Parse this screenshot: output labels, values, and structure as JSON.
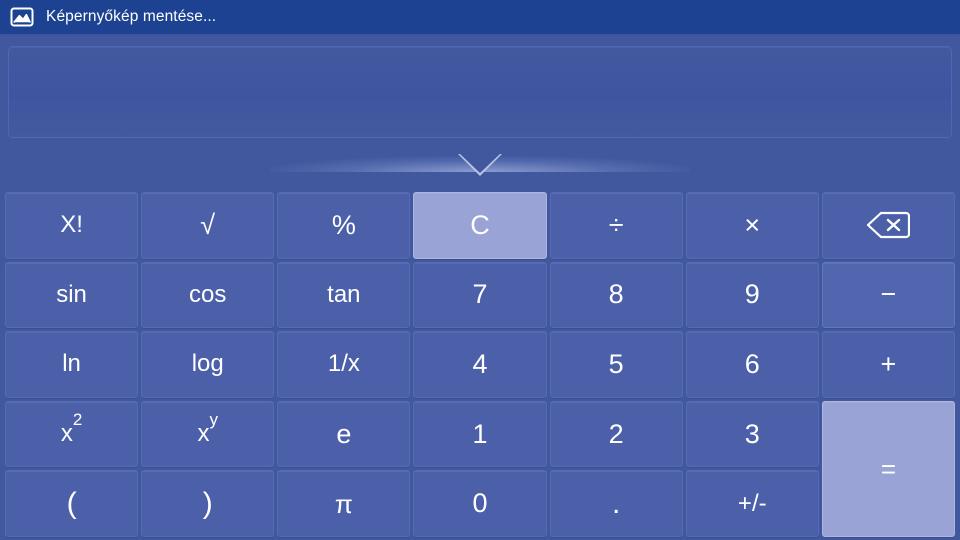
{
  "titlebar": {
    "icon": "image-picture-icon",
    "text": "Képernyőkép mentése..."
  },
  "display": {
    "value": "",
    "placeholder": ""
  },
  "colors": {
    "titlebar_bg": "#1c4291",
    "app_bg": "#41589f",
    "key_bg": "#4b60a9",
    "key_alt_bg": "#5266b0",
    "key_highlight_bg": "#9aa3d6",
    "key_text": "#ffffff",
    "caret": "#b9c4ea"
  },
  "keypad": {
    "columns": 7,
    "rows": 5,
    "keys": [
      {
        "id": "factorial",
        "label": "X!",
        "name": "key-factorial",
        "style": "normal"
      },
      {
        "id": "sqrt",
        "label": "√",
        "name": "key-square-root",
        "style": "normal"
      },
      {
        "id": "percent",
        "label": "%",
        "name": "key-percent",
        "style": "normal"
      },
      {
        "id": "clear",
        "label": "C",
        "name": "key-clear",
        "style": "highlight"
      },
      {
        "id": "divide",
        "label": "÷",
        "name": "key-divide",
        "style": "normal"
      },
      {
        "id": "multiply",
        "label": "×",
        "name": "key-multiply",
        "style": "normal"
      },
      {
        "id": "backspace",
        "label": "",
        "name": "key-backspace",
        "style": "normal"
      },
      {
        "id": "sin",
        "label": "sin",
        "name": "key-sin",
        "style": "normal"
      },
      {
        "id": "cos",
        "label": "cos",
        "name": "key-cos",
        "style": "normal"
      },
      {
        "id": "tan",
        "label": "tan",
        "name": "key-tan",
        "style": "normal"
      },
      {
        "id": "7",
        "label": "7",
        "name": "key-digit-7",
        "style": "normal"
      },
      {
        "id": "8",
        "label": "8",
        "name": "key-digit-8",
        "style": "normal"
      },
      {
        "id": "9",
        "label": "9",
        "name": "key-digit-9",
        "style": "normal"
      },
      {
        "id": "minus",
        "label": "−",
        "name": "key-minus",
        "style": "alt"
      },
      {
        "id": "ln",
        "label": "ln",
        "name": "key-ln",
        "style": "normal"
      },
      {
        "id": "log",
        "label": "log",
        "name": "key-log",
        "style": "normal"
      },
      {
        "id": "invx",
        "label": "1/x",
        "name": "key-reciprocal",
        "style": "normal"
      },
      {
        "id": "4",
        "label": "4",
        "name": "key-digit-4",
        "style": "normal"
      },
      {
        "id": "5",
        "label": "5",
        "name": "key-digit-5",
        "style": "normal"
      },
      {
        "id": "6",
        "label": "6",
        "name": "key-digit-6",
        "style": "normal"
      },
      {
        "id": "plus",
        "label": "+",
        "name": "key-plus",
        "style": "normal"
      },
      {
        "id": "xsq",
        "label": "x2",
        "name": "key-x-squared",
        "style": "normal"
      },
      {
        "id": "xpow",
        "label": "xy",
        "name": "key-x-power-y",
        "style": "normal"
      },
      {
        "id": "e",
        "label": "e",
        "name": "key-e",
        "style": "normal"
      },
      {
        "id": "1",
        "label": "1",
        "name": "key-digit-1",
        "style": "normal"
      },
      {
        "id": "2",
        "label": "2",
        "name": "key-digit-2",
        "style": "normal"
      },
      {
        "id": "3",
        "label": "3",
        "name": "key-digit-3",
        "style": "normal"
      },
      {
        "id": "equals",
        "label": "=",
        "name": "key-equals",
        "style": "highlight"
      },
      {
        "id": "lparen",
        "label": "(",
        "name": "key-left-paren",
        "style": "normal"
      },
      {
        "id": "rparen",
        "label": ")",
        "name": "key-right-paren",
        "style": "normal"
      },
      {
        "id": "pi",
        "label": "π",
        "name": "key-pi",
        "style": "normal"
      },
      {
        "id": "0",
        "label": "0",
        "name": "key-digit-0",
        "style": "normal"
      },
      {
        "id": "decimal",
        "label": ".",
        "name": "key-decimal-point",
        "style": "normal"
      },
      {
        "id": "plusminus",
        "label": "+/-",
        "name": "key-sign-toggle",
        "style": "normal"
      }
    ]
  }
}
